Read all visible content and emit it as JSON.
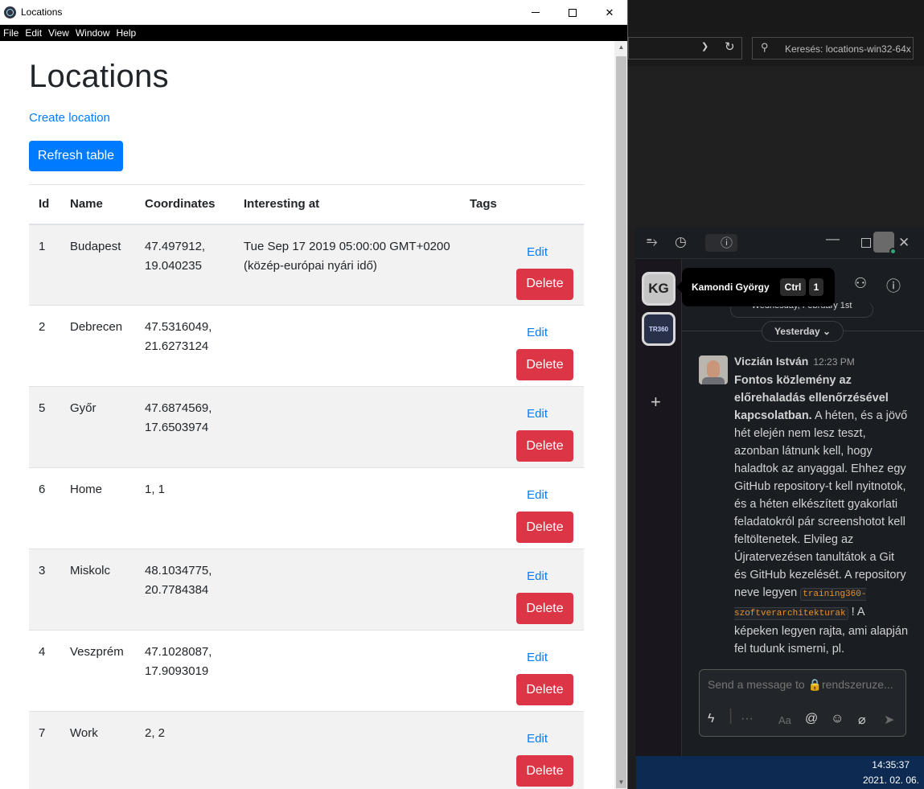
{
  "window": {
    "title": "Locations",
    "controls": {
      "minimize": "minimize-icon",
      "maximize": "maximize-icon",
      "close": "✕"
    }
  },
  "menu": [
    "File",
    "Edit",
    "View",
    "Window",
    "Help"
  ],
  "page": {
    "title": "Locations",
    "create_link": "Create location",
    "refresh_button": "Refresh table"
  },
  "table": {
    "headers": [
      "Id",
      "Name",
      "Coordinates",
      "Interesting at",
      "Tags"
    ],
    "edit_label": "Edit",
    "delete_label": "Delete",
    "rows": [
      {
        "id": "1",
        "name": "Budapest",
        "coordinates": "47.497912, 19.040235",
        "interesting_at": "Tue Sep 17 2019 05:00:00 GMT+0200 (közép-európai nyári idő)",
        "tags": "",
        "edit": "Edit",
        "delete": "Delete"
      },
      {
        "id": "2",
        "name": "Debrecen",
        "coordinates": "47.5316049, 21.6273124",
        "interesting_at": "",
        "tags": "",
        "edit": "Edit",
        "delete": "Delete"
      },
      {
        "id": "5",
        "name": "Győr",
        "coordinates": "47.6874569, 17.6503974",
        "interesting_at": "",
        "tags": "",
        "edit": "Edit",
        "delete": "Delete"
      },
      {
        "id": "6",
        "name": "Home",
        "coordinates": "1, 1",
        "interesting_at": "",
        "tags": "",
        "edit": "Edit",
        "delete": "Delete"
      },
      {
        "id": "3",
        "name": "Miskolc",
        "coordinates": "48.1034775, 20.7784384",
        "interesting_at": "",
        "tags": "",
        "edit": "Edit",
        "delete": "Delete"
      },
      {
        "id": "4",
        "name": "Veszprém",
        "coordinates": "47.1028087, 17.9093019",
        "interesting_at": "",
        "tags": "",
        "edit": "Edit",
        "delete": "Delete"
      },
      {
        "id": "7",
        "name": "Work",
        "coordinates": "2, 2",
        "interesting_at": "",
        "tags": "",
        "edit": "Edit",
        "delete": "Delete"
      }
    ]
  },
  "explorer": {
    "search_text": "Keresés: locations-win32-64x"
  },
  "slack": {
    "workspaces": [
      {
        "initials": "KG",
        "icon": "kg-workspace"
      },
      {
        "initials": "TR360",
        "icon": "training360-workspace"
      }
    ],
    "tooltip": {
      "name": "Kamondi György",
      "key1": "Ctrl",
      "key2": "1"
    },
    "date_old": "Wednesday, February 1st",
    "date_divider": "Yesterday",
    "message": {
      "author": "Viczián István",
      "time": "12:23 PM",
      "bold_text": "Fontos közlemény az előrehaladás ellenőrzésével kapcsolatban.",
      "text": "A héten, és a jövő hét elején nem lesz teszt, azonban látnunk kell, hogy haladtok az anyaggal. Ehhez egy GitHub repository-t kell nyitnotok, és a héten elkészített gyakorlati feladatokról pár screenshotot kell feltöltenetek. Elvileg az Újratervezésen tanultátok a Git és GitHub kezelését. A repository neve legyen",
      "code": "training360-szoftverarchitekturak",
      "text_after": "! A képeken legyen rajta, ami alapján fel tudunk ismerni, pl."
    },
    "composer_placeholder": "Send a message to 🔒rendszeruze..."
  },
  "taskbar": {
    "time": "14:35:37",
    "date": "2021. 02. 06."
  },
  "colors": {
    "primary": "#007bff",
    "danger": "#dc3545",
    "slack_bg": "#1a1d21"
  }
}
